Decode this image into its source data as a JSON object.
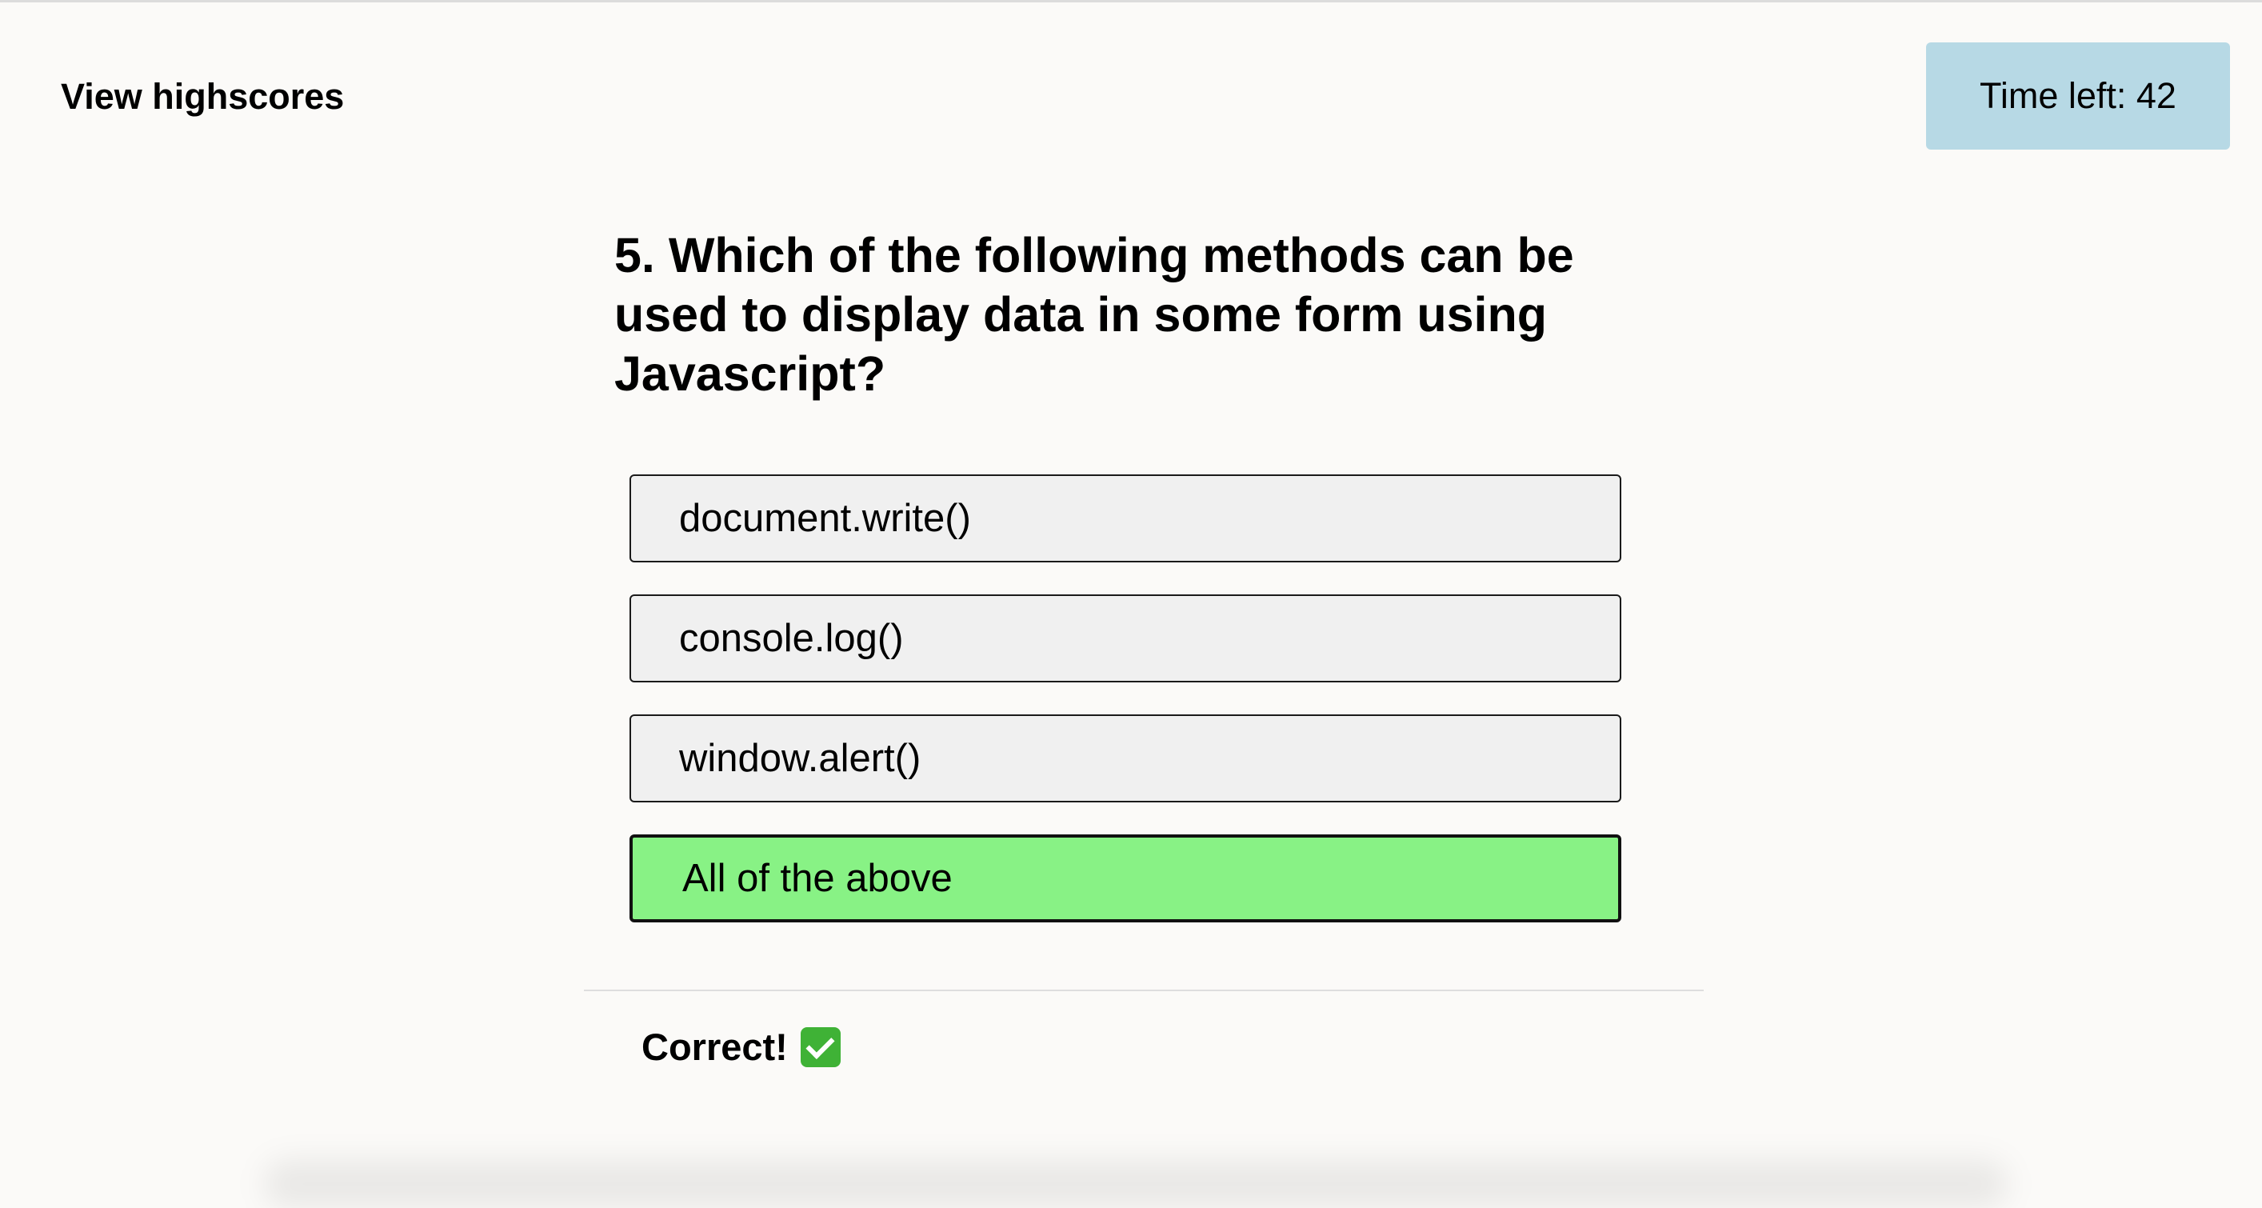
{
  "header": {
    "highscores_label": "View highscores",
    "timer_label": "Time left: 42"
  },
  "quiz": {
    "question": "5. Which of the following methods can be used to display data in some form using Javascript?",
    "choices": [
      {
        "label": "document.write()",
        "state": "default"
      },
      {
        "label": "console.log()",
        "state": "default"
      },
      {
        "label": "window.alert()",
        "state": "default"
      },
      {
        "label": "All of the above",
        "state": "correct"
      }
    ],
    "feedback": "Correct!",
    "feedback_icon": "check-mark-icon"
  },
  "colors": {
    "background": "#fbfaf8",
    "timer_bg": "#b7d9e5",
    "choice_bg": "#f0f0f0",
    "correct_bg": "#88f285",
    "check_icon": "#3fb236"
  }
}
